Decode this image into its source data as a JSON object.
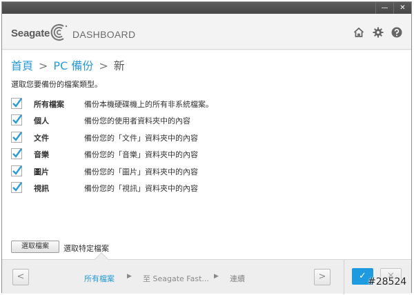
{
  "window": {
    "minimize_glyph": "—",
    "close_glyph": "✕"
  },
  "header": {
    "brand": "Seagate",
    "product": "DASHBOARD",
    "icons": [
      "home-icon",
      "gear-icon",
      "help-icon"
    ]
  },
  "breadcrumb": {
    "home": "首頁",
    "section": "PC 備份",
    "current": "新",
    "separator": ">"
  },
  "instruction": "選取您要備份的檔案類型。",
  "file_types": [
    {
      "name": "所有檔案",
      "description": "備份本機硬碟機上的所有非系統檔案。",
      "checked": true
    },
    {
      "name": "個人",
      "description": "備份您的使用者資料夾中的內容",
      "checked": true
    },
    {
      "name": "文件",
      "description": "備份您的「文件」資料夾中的內容",
      "checked": true
    },
    {
      "name": "音樂",
      "description": "備份您的「音樂」資料夾中的內容",
      "checked": true
    },
    {
      "name": "圖片",
      "description": "備份您的「圖片」資料夾中的內容",
      "checked": true
    },
    {
      "name": "視訊",
      "description": "備份您的「視訊」資料夾中的內容",
      "checked": true
    }
  ],
  "select_files": {
    "button": "選取檔案",
    "label": "選取特定檔案"
  },
  "footer": {
    "prev_glyph": "<",
    "next_glyph": ">",
    "steps": [
      "所有檔案",
      "至 Seagate Fast...",
      "連續"
    ],
    "step_arrow": "▶",
    "ok_glyph": "✓",
    "cancel_glyph": "✕"
  },
  "watermark": "#28524",
  "colors": {
    "accent": "#2a9ad6",
    "ok_button": "#1e9ae0",
    "titlebar": "#4f4f4f"
  }
}
